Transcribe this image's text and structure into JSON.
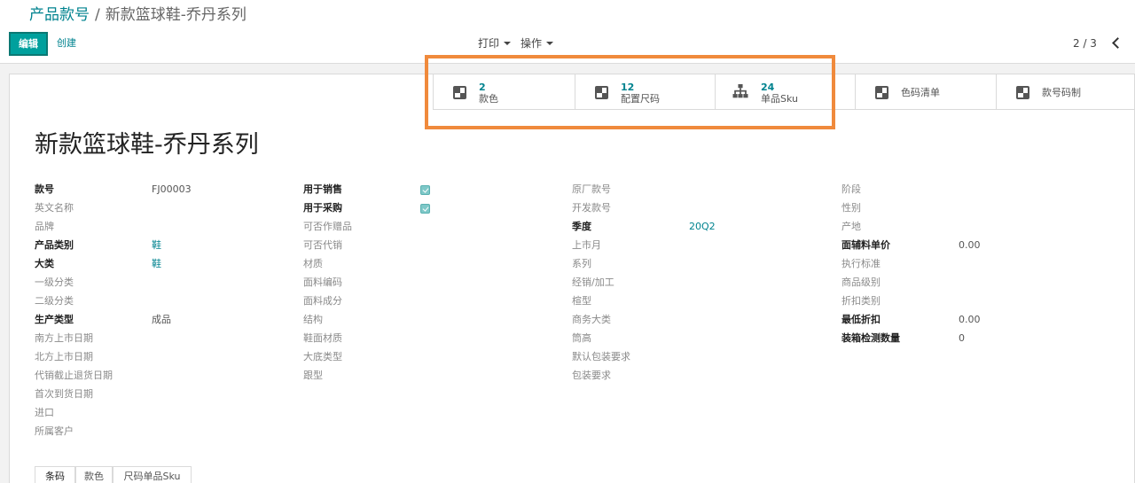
{
  "breadcrumb": {
    "parent": "产品款号",
    "separator": "/",
    "current": "新款篮球鞋-乔丹系列"
  },
  "actions": {
    "edit": "编辑",
    "create": "创建"
  },
  "toolbar": {
    "print": "打印",
    "action": "操作"
  },
  "pager": {
    "value": "2 / 3"
  },
  "smart_buttons": [
    {
      "count": "2",
      "label": "款色",
      "icon": "checker-icon"
    },
    {
      "count": "12",
      "label": "配置尺码",
      "icon": "checker-icon"
    },
    {
      "count": "24",
      "label": "单品Sku",
      "icon": "sitemap-icon"
    },
    {
      "label": "色码清单",
      "icon": "checker-icon"
    },
    {
      "label": "款号码制",
      "icon": "checker-icon"
    }
  ],
  "record": {
    "title": "新款篮球鞋-乔丹系列"
  },
  "columns": [
    [
      {
        "label": "款号",
        "value": "FJ00003"
      },
      {
        "label": "英文名称"
      },
      {
        "label": "品牌"
      },
      {
        "label": "产品类别",
        "value": "鞋"
      },
      {
        "label": "大类",
        "value": "鞋"
      },
      {
        "label": "一级分类"
      },
      {
        "label": "二级分类"
      },
      {
        "label": "生产类型",
        "value": "成品"
      },
      {
        "label": "南方上市日期"
      },
      {
        "label": "北方上市日期"
      },
      {
        "label": "代销截止退货日期"
      },
      {
        "label": "首次到货日期"
      },
      {
        "label": "进口"
      },
      {
        "label": "所属客户"
      }
    ],
    [
      {
        "label": "用于销售",
        "checked": true
      },
      {
        "label": "用于采购",
        "checked": true
      },
      {
        "label": "可否作赠品"
      },
      {
        "label": "可否代销"
      },
      {
        "label": "材质"
      },
      {
        "label": "面料编码"
      },
      {
        "label": "面料成分"
      },
      {
        "label": "结构"
      },
      {
        "label": "鞋面材质"
      },
      {
        "label": "大底类型"
      },
      {
        "label": "跟型"
      }
    ],
    [
      {
        "label": "原厂款号"
      },
      {
        "label": "开发款号"
      },
      {
        "label": "季度",
        "value": "20Q2"
      },
      {
        "label": "上市月"
      },
      {
        "label": "系列"
      },
      {
        "label": "经销/加工"
      },
      {
        "label": "楦型"
      },
      {
        "label": "商务大类"
      },
      {
        "label": "筒高"
      },
      {
        "label": "默认包装要求"
      },
      {
        "label": "包装要求"
      }
    ],
    [
      {
        "label": "阶段"
      },
      {
        "label": "性别"
      },
      {
        "label": "产地"
      },
      {
        "label": "面辅料单价",
        "value": "0.00"
      },
      {
        "label": "执行标准"
      },
      {
        "label": "商品级别"
      },
      {
        "label": "折扣类别"
      },
      {
        "label": "最低折扣",
        "value": "0.00"
      },
      {
        "label": "装箱检测数量",
        "value": "0"
      }
    ]
  ],
  "tabs": [
    "条码",
    "款色",
    "尺码单品Sku"
  ],
  "colors": {
    "accent": "#00a09d",
    "link": "#00838f",
    "highlight": "#f08a3c"
  }
}
